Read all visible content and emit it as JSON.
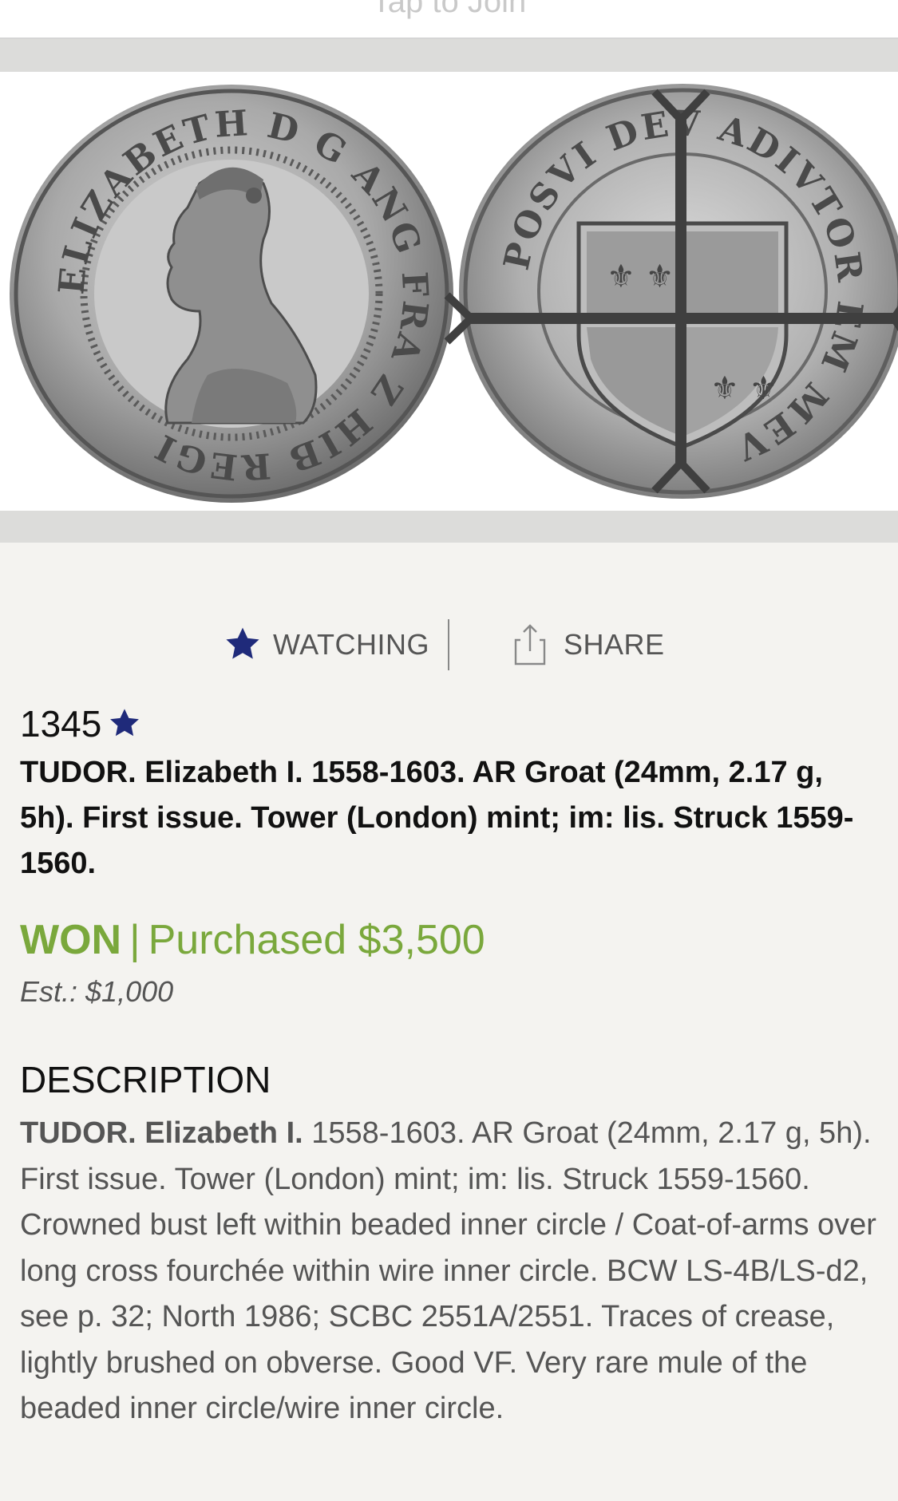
{
  "header": {
    "tap_to_join": "Tap to Join"
  },
  "coin_image": {
    "obverse_legend": "ELIZABETH D G ANG FRA Z HIB REGI",
    "reverse_legend": "POSVI DEV ADIVTOR EM MEV"
  },
  "actions": {
    "watching_label": "WATCHING",
    "share_label": "SHARE"
  },
  "lot": {
    "number": "1345",
    "title": "TUDOR. Elizabeth I. 1558-1603. AR Groat (24mm, 2.17 g, 5h). First issue. Tower (London) mint; im: lis. Struck 1559-1560.",
    "status_won": "WON",
    "status_sep": "|",
    "status_price": "Purchased $3,500",
    "estimate": "Est.: $1,000"
  },
  "description": {
    "heading": "DESCRIPTION",
    "lead": "TUDOR. Elizabeth I.",
    "body": " 1558-1603. AR Groat (24mm, 2.17 g, 5h). First issue. Tower (London) mint; im: lis. Struck 1559-1560. Crowned bust left within beaded inner circle / Coat-of-arms over long cross fourchée within wire inner circle. BCW LS-4B/LS-d2, see p. 32; North 1986; SCBC 2551A/2551. Traces of crease, lightly brushed on obverse. Good VF. Very rare mule of the beaded inner circle/wire inner circle."
  },
  "colors": {
    "accent_blue": "#1f2a7a",
    "won_green": "#7aa83c",
    "text_gray": "#555555"
  }
}
